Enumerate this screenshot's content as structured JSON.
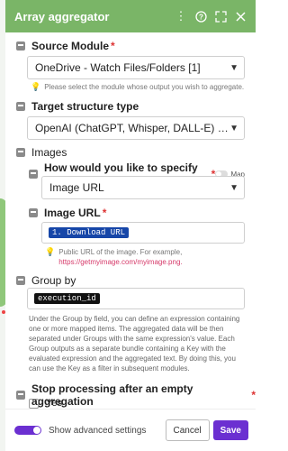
{
  "dialog": {
    "title": "Array aggregator",
    "header_color": "#7ab567",
    "icons": [
      "more-vertical-icon",
      "help-icon",
      "expand-icon",
      "close-icon"
    ]
  },
  "source_module": {
    "label": "Source Module",
    "required_mark": "*",
    "value": "OneDrive - Watch Files/Folders [1]",
    "hint": "Please select the module whose output you wish to aggregate."
  },
  "target_structure": {
    "label": "Target structure type",
    "value": "OpenAI (ChatGPT, Whisper, DALL-E) - A..."
  },
  "images": {
    "label": "Images",
    "specify": {
      "label": "How would you like to specify an image?",
      "required_mark": "*",
      "toggle_label": "Map",
      "value": "Image URL"
    },
    "image_url": {
      "label": "Image URL",
      "required_mark": "*",
      "token": "1. Download URL",
      "hint_line1": "Public URL of the image. For example,",
      "hint_link": "https://getmyimage.com/myimage.png."
    }
  },
  "group_by": {
    "label": "Group by",
    "token": "execution_id",
    "description": "Under the Group by field, you can define an expression containing one or more mapped items. The aggregated data will be then separated under Groups with the same expression's value. Each Group outputs as a separate bundle containing a Key with the evaluated expression and the aggregated text. By doing this, you can use the Key as a filter in subsequent modules."
  },
  "stop_processing": {
    "label": "Stop processing after an empty aggregation",
    "required_mark": "*",
    "option": "Yes"
  },
  "footer": {
    "advanced_label": "Show advanced settings",
    "advanced_on": true,
    "cancel_label": "Cancel",
    "save_label": "Save",
    "accent_color": "#6b2fd1"
  }
}
